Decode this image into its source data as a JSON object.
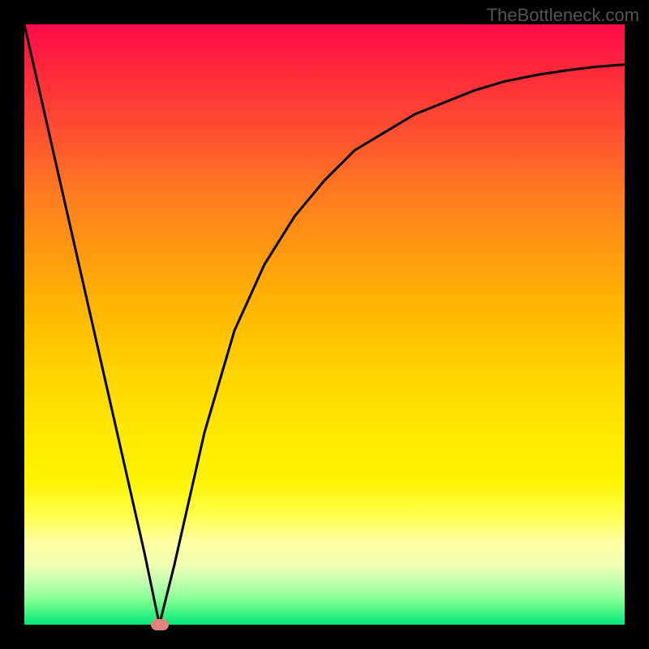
{
  "watermark": "TheBottleneck.com",
  "chart_data": {
    "type": "line",
    "title": "",
    "xlabel": "",
    "ylabel": "",
    "xlim": [
      0,
      100
    ],
    "ylim": [
      0,
      100
    ],
    "grid": false,
    "legend": false,
    "background_gradient": {
      "type": "vertical",
      "stops": [
        {
          "pos": 0,
          "color": "#ff0a4a"
        },
        {
          "pos": 50,
          "color": "#ffd400"
        },
        {
          "pos": 85,
          "color": "#ffff80"
        },
        {
          "pos": 100,
          "color": "#00e878"
        }
      ]
    },
    "series": [
      {
        "name": "bottleneck-curve",
        "color": "#000000",
        "x": [
          0,
          5,
          10,
          15,
          20,
          22.5,
          25,
          30,
          35,
          40,
          45,
          50,
          55,
          60,
          65,
          70,
          75,
          80,
          85,
          90,
          95,
          100
        ],
        "values": [
          100,
          78,
          56,
          34,
          12,
          0,
          10,
          32,
          49,
          60,
          68,
          74,
          79,
          82,
          85,
          87,
          89,
          90.5,
          91.5,
          92.3,
          92.9,
          93.3
        ]
      }
    ],
    "annotations": [
      {
        "name": "optimal-marker",
        "x": 22.5,
        "y": 0,
        "shape": "pill",
        "color": "#e0857d"
      }
    ]
  }
}
